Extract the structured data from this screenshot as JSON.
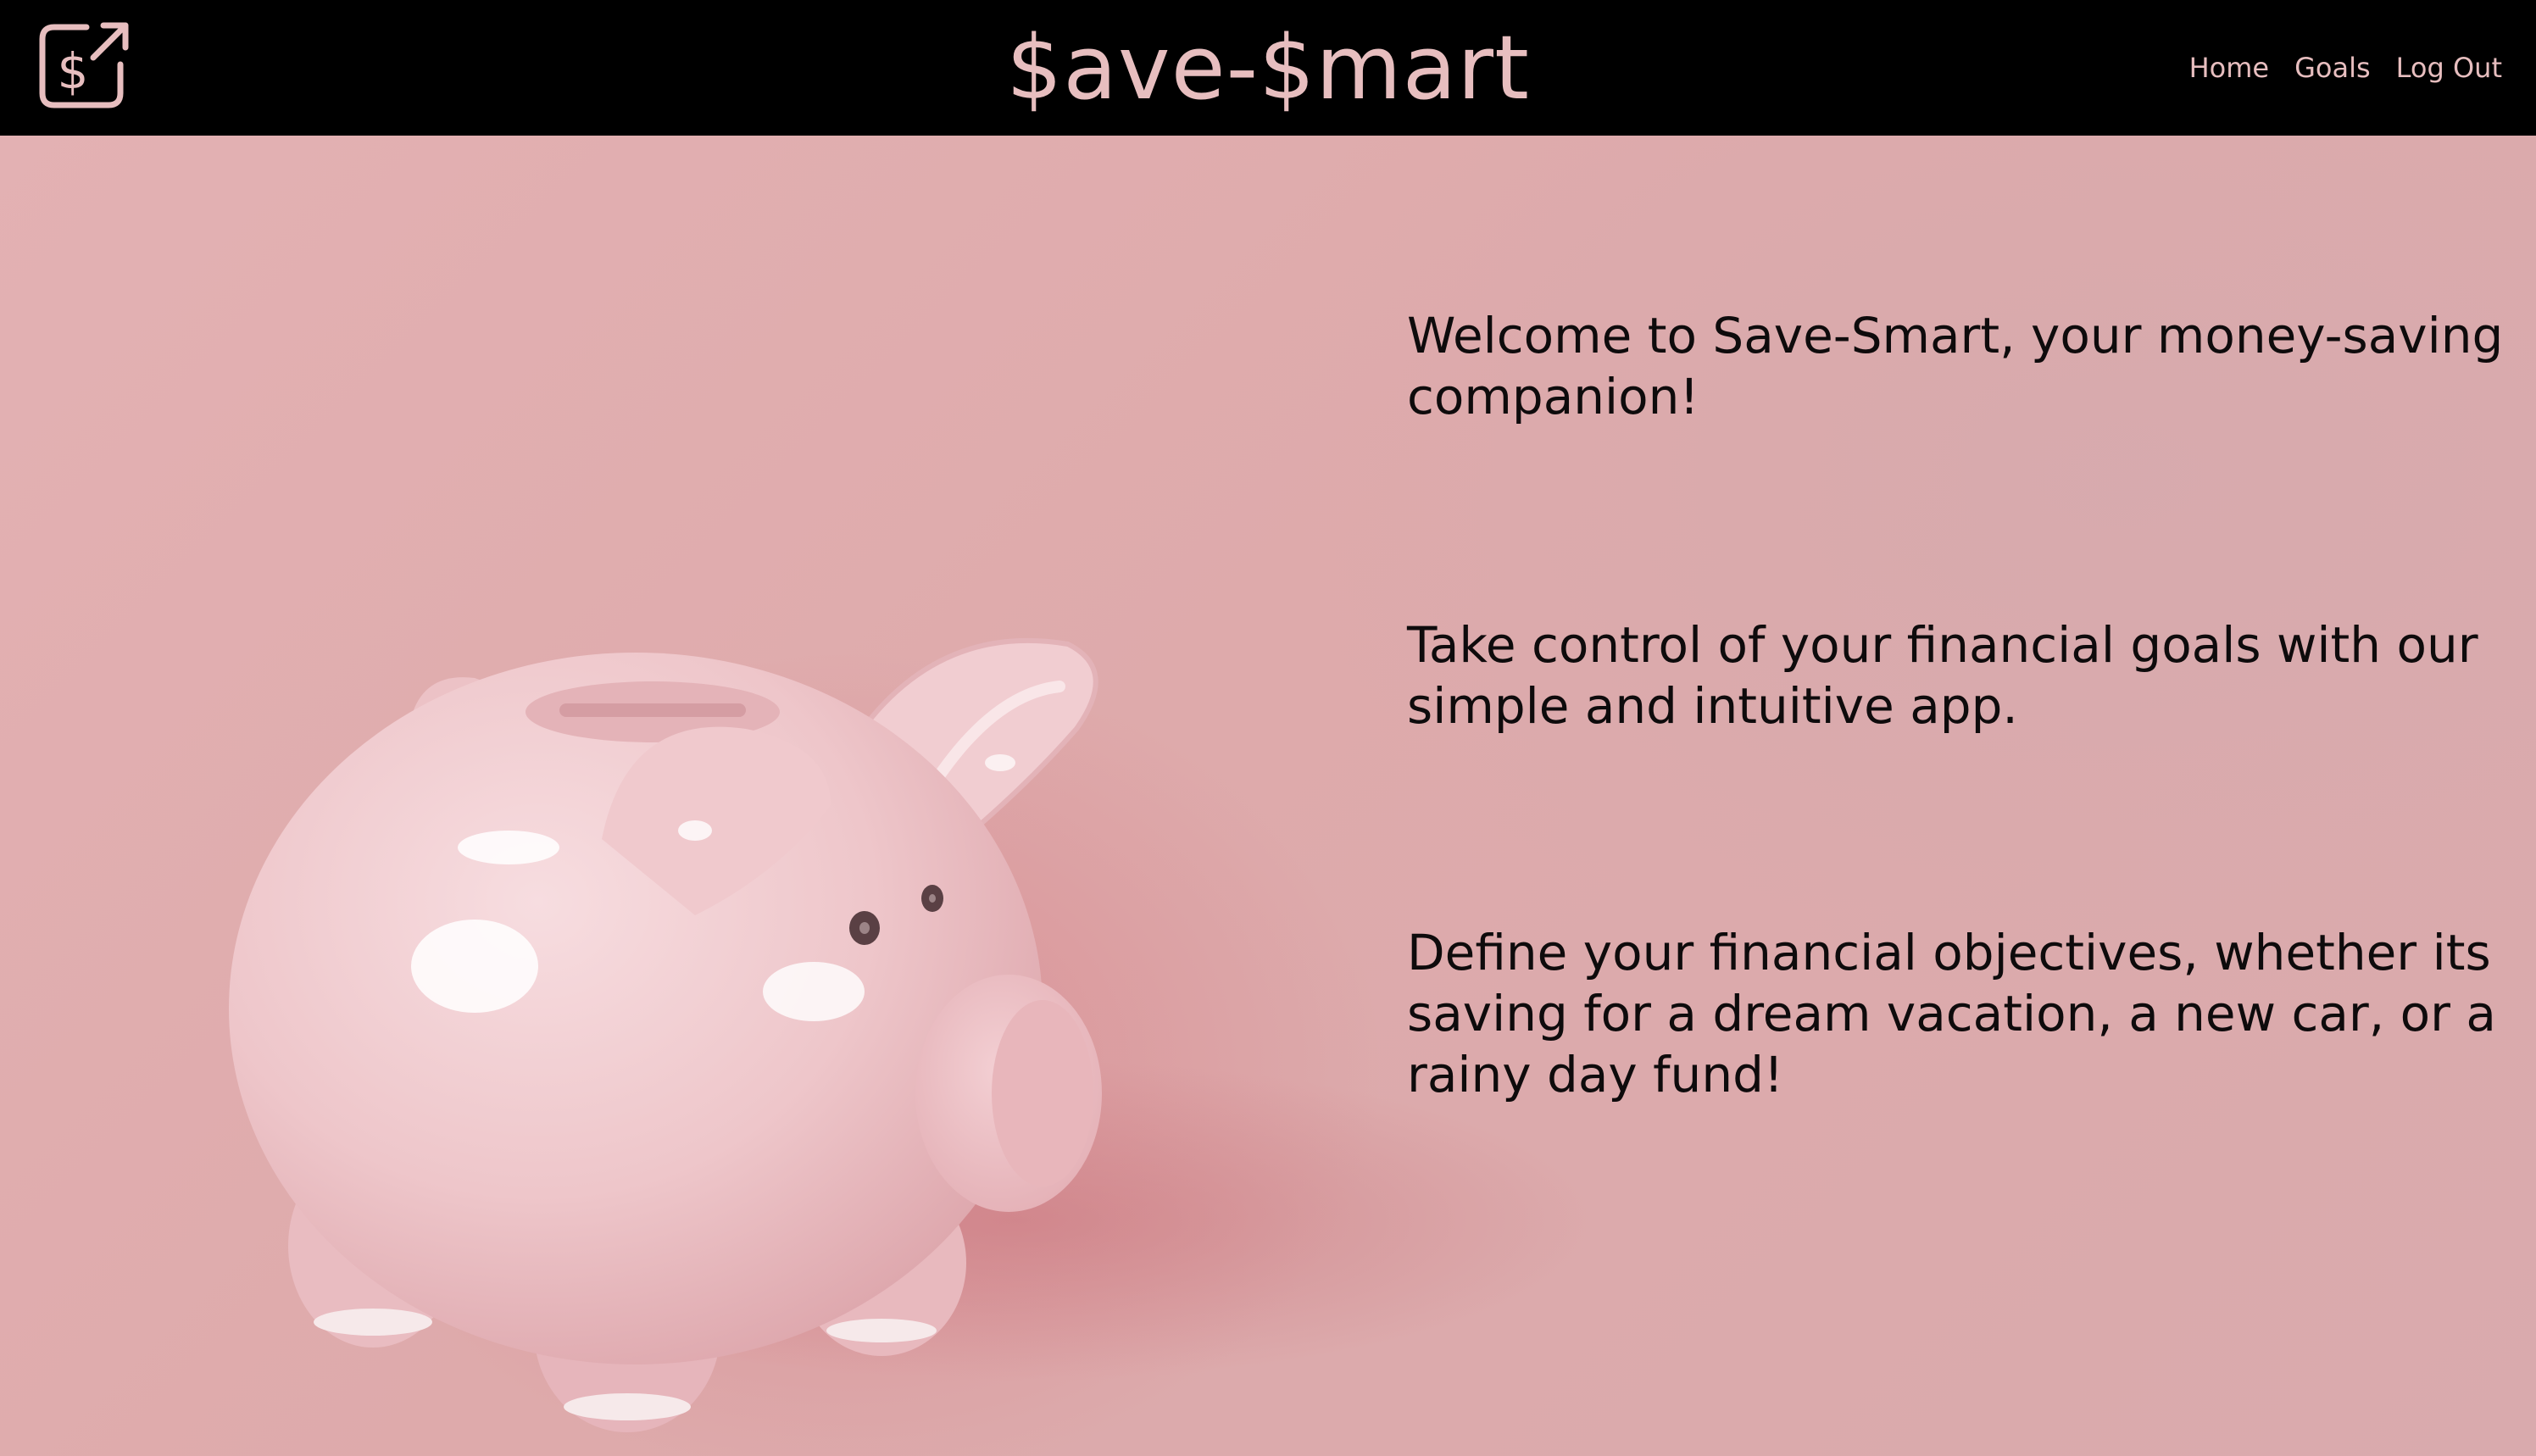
{
  "header": {
    "logo_icon": "dollar-export-icon",
    "title": "$ave-$mart",
    "nav": {
      "home": "Home",
      "goals": "Goals",
      "logout": "Log Out"
    }
  },
  "hero": {
    "image": "piggy-bank-photo",
    "paragraphs": {
      "welcome": "Welcome to Save-Smart, your money-saving companion!",
      "control": "Take control of your financial goals with our simple and intuitive app.",
      "define": "Define your financial objectives, whether its saving for a dream vacation, a new car, or a rainy day fund!"
    }
  },
  "colors": {
    "header_bg": "#000000",
    "accent_pink": "#e7bebf",
    "hero_bg": "#dfb0b1",
    "text_dark": "#0e0b0c"
  }
}
